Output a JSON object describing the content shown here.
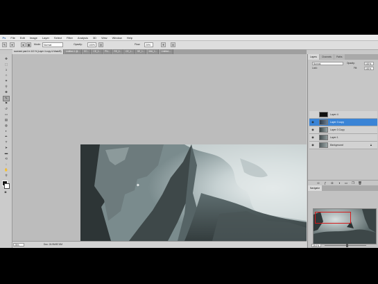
{
  "menubar": {
    "items": [
      "Ps",
      "File",
      "Edit",
      "Image",
      "Layer",
      "Select",
      "Filter",
      "Analysis",
      "3D",
      "View",
      "Window",
      "Help"
    ]
  },
  "options": {
    "mode_label": "Mode:",
    "mode_value": "Normal",
    "opacity_label": "Opacity:",
    "opacity_value": "100%",
    "flow_label": "Flow:",
    "flow_value": "20%"
  },
  "document": {
    "tabs": [
      "scanned pan4 in 113 % (Layer 4 copy & Mask/8)",
      "Untitled-1 @...",
      "EC...",
      "CE_1...",
      "PN...",
      "RE_0...",
      "CE_1...",
      "SE_1...",
      "IMA_1...",
      "Untitled-..."
    ],
    "zoom": "25%",
    "info": "Doc: 24.9M/87.8M"
  },
  "layers_panel": {
    "tabs": [
      "Layers",
      "Channels",
      "Paths"
    ],
    "blend_mode": "Normal",
    "opacity_label": "Opacity:",
    "opacity": "100%",
    "lock_label": "Lock:",
    "fill_label": "Fill:",
    "fill": "100%",
    "layers": [
      {
        "name": "Layer 4",
        "visible": false,
        "selected": false,
        "locked": false
      },
      {
        "name": "Layer 3 copy",
        "visible": true,
        "selected": true,
        "locked": false
      },
      {
        "name": "Layer 3 Copy",
        "visible": true,
        "selected": false,
        "locked": false
      },
      {
        "name": "Layer 1",
        "visible": true,
        "selected": false,
        "locked": false
      },
      {
        "name": "Background",
        "visible": true,
        "selected": false,
        "locked": true
      }
    ]
  },
  "navigator": {
    "title": "Navigator",
    "zoom": "25.0%",
    "zoom_fraction": 0.55
  },
  "colors": {
    "selection": "#3a84d6",
    "view_box": "#d51a1a",
    "foreground": "#111111",
    "background": "#ffffff"
  }
}
